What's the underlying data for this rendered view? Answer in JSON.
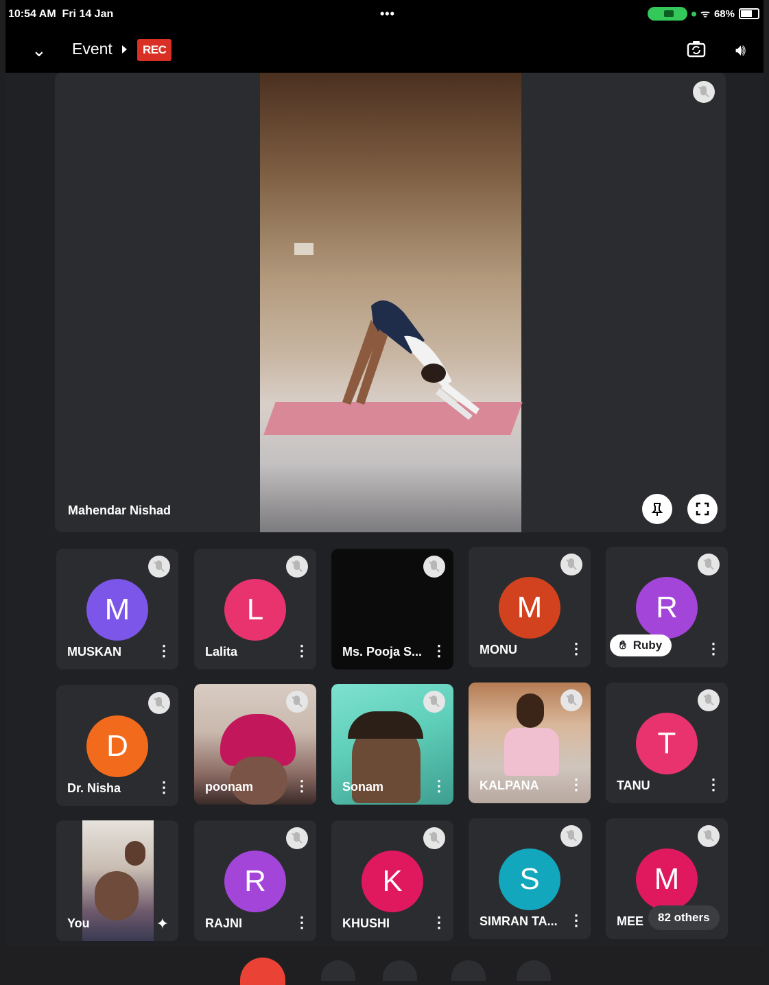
{
  "status_bar": {
    "time": "10:54 AM",
    "date": "Fri 14 Jan",
    "battery": "68%"
  },
  "app_bar": {
    "title": "Event",
    "rec_badge": "REC"
  },
  "main_video": {
    "speaker": "Mahendar Nishad"
  },
  "participants": [
    {
      "name": "MUSKAN",
      "initial": "M",
      "color": "#7c56e8"
    },
    {
      "name": "Lalita",
      "initial": "L",
      "color": "#e8336f"
    },
    {
      "name": "Ms. Pooja S...",
      "initial": "",
      "color": ""
    },
    {
      "name": "MONU",
      "initial": "M",
      "color": "#d2421e"
    },
    {
      "name": "Ruby",
      "initial": "R",
      "color": "#a445d9"
    },
    {
      "name": "Dr. Nisha",
      "initial": "D",
      "color": "#f26a1b"
    },
    {
      "name": "poonam",
      "initial": "",
      "color": ""
    },
    {
      "name": "Sonam",
      "initial": "",
      "color": ""
    },
    {
      "name": "KALPANA",
      "initial": "",
      "color": ""
    },
    {
      "name": "TANU",
      "initial": "T",
      "color": "#e8336f"
    },
    {
      "name": "You",
      "initial": "",
      "color": ""
    },
    {
      "name": "RAJNI",
      "initial": "R",
      "color": "#a445d9"
    },
    {
      "name": "KHUSHI",
      "initial": "K",
      "color": "#e0195e"
    },
    {
      "name": "SIMRAN TA...",
      "initial": "S",
      "color": "#12a7bd"
    },
    {
      "name": "MEE",
      "initial": "M",
      "color": "#e0195e"
    }
  ],
  "others_badge": "82 others"
}
